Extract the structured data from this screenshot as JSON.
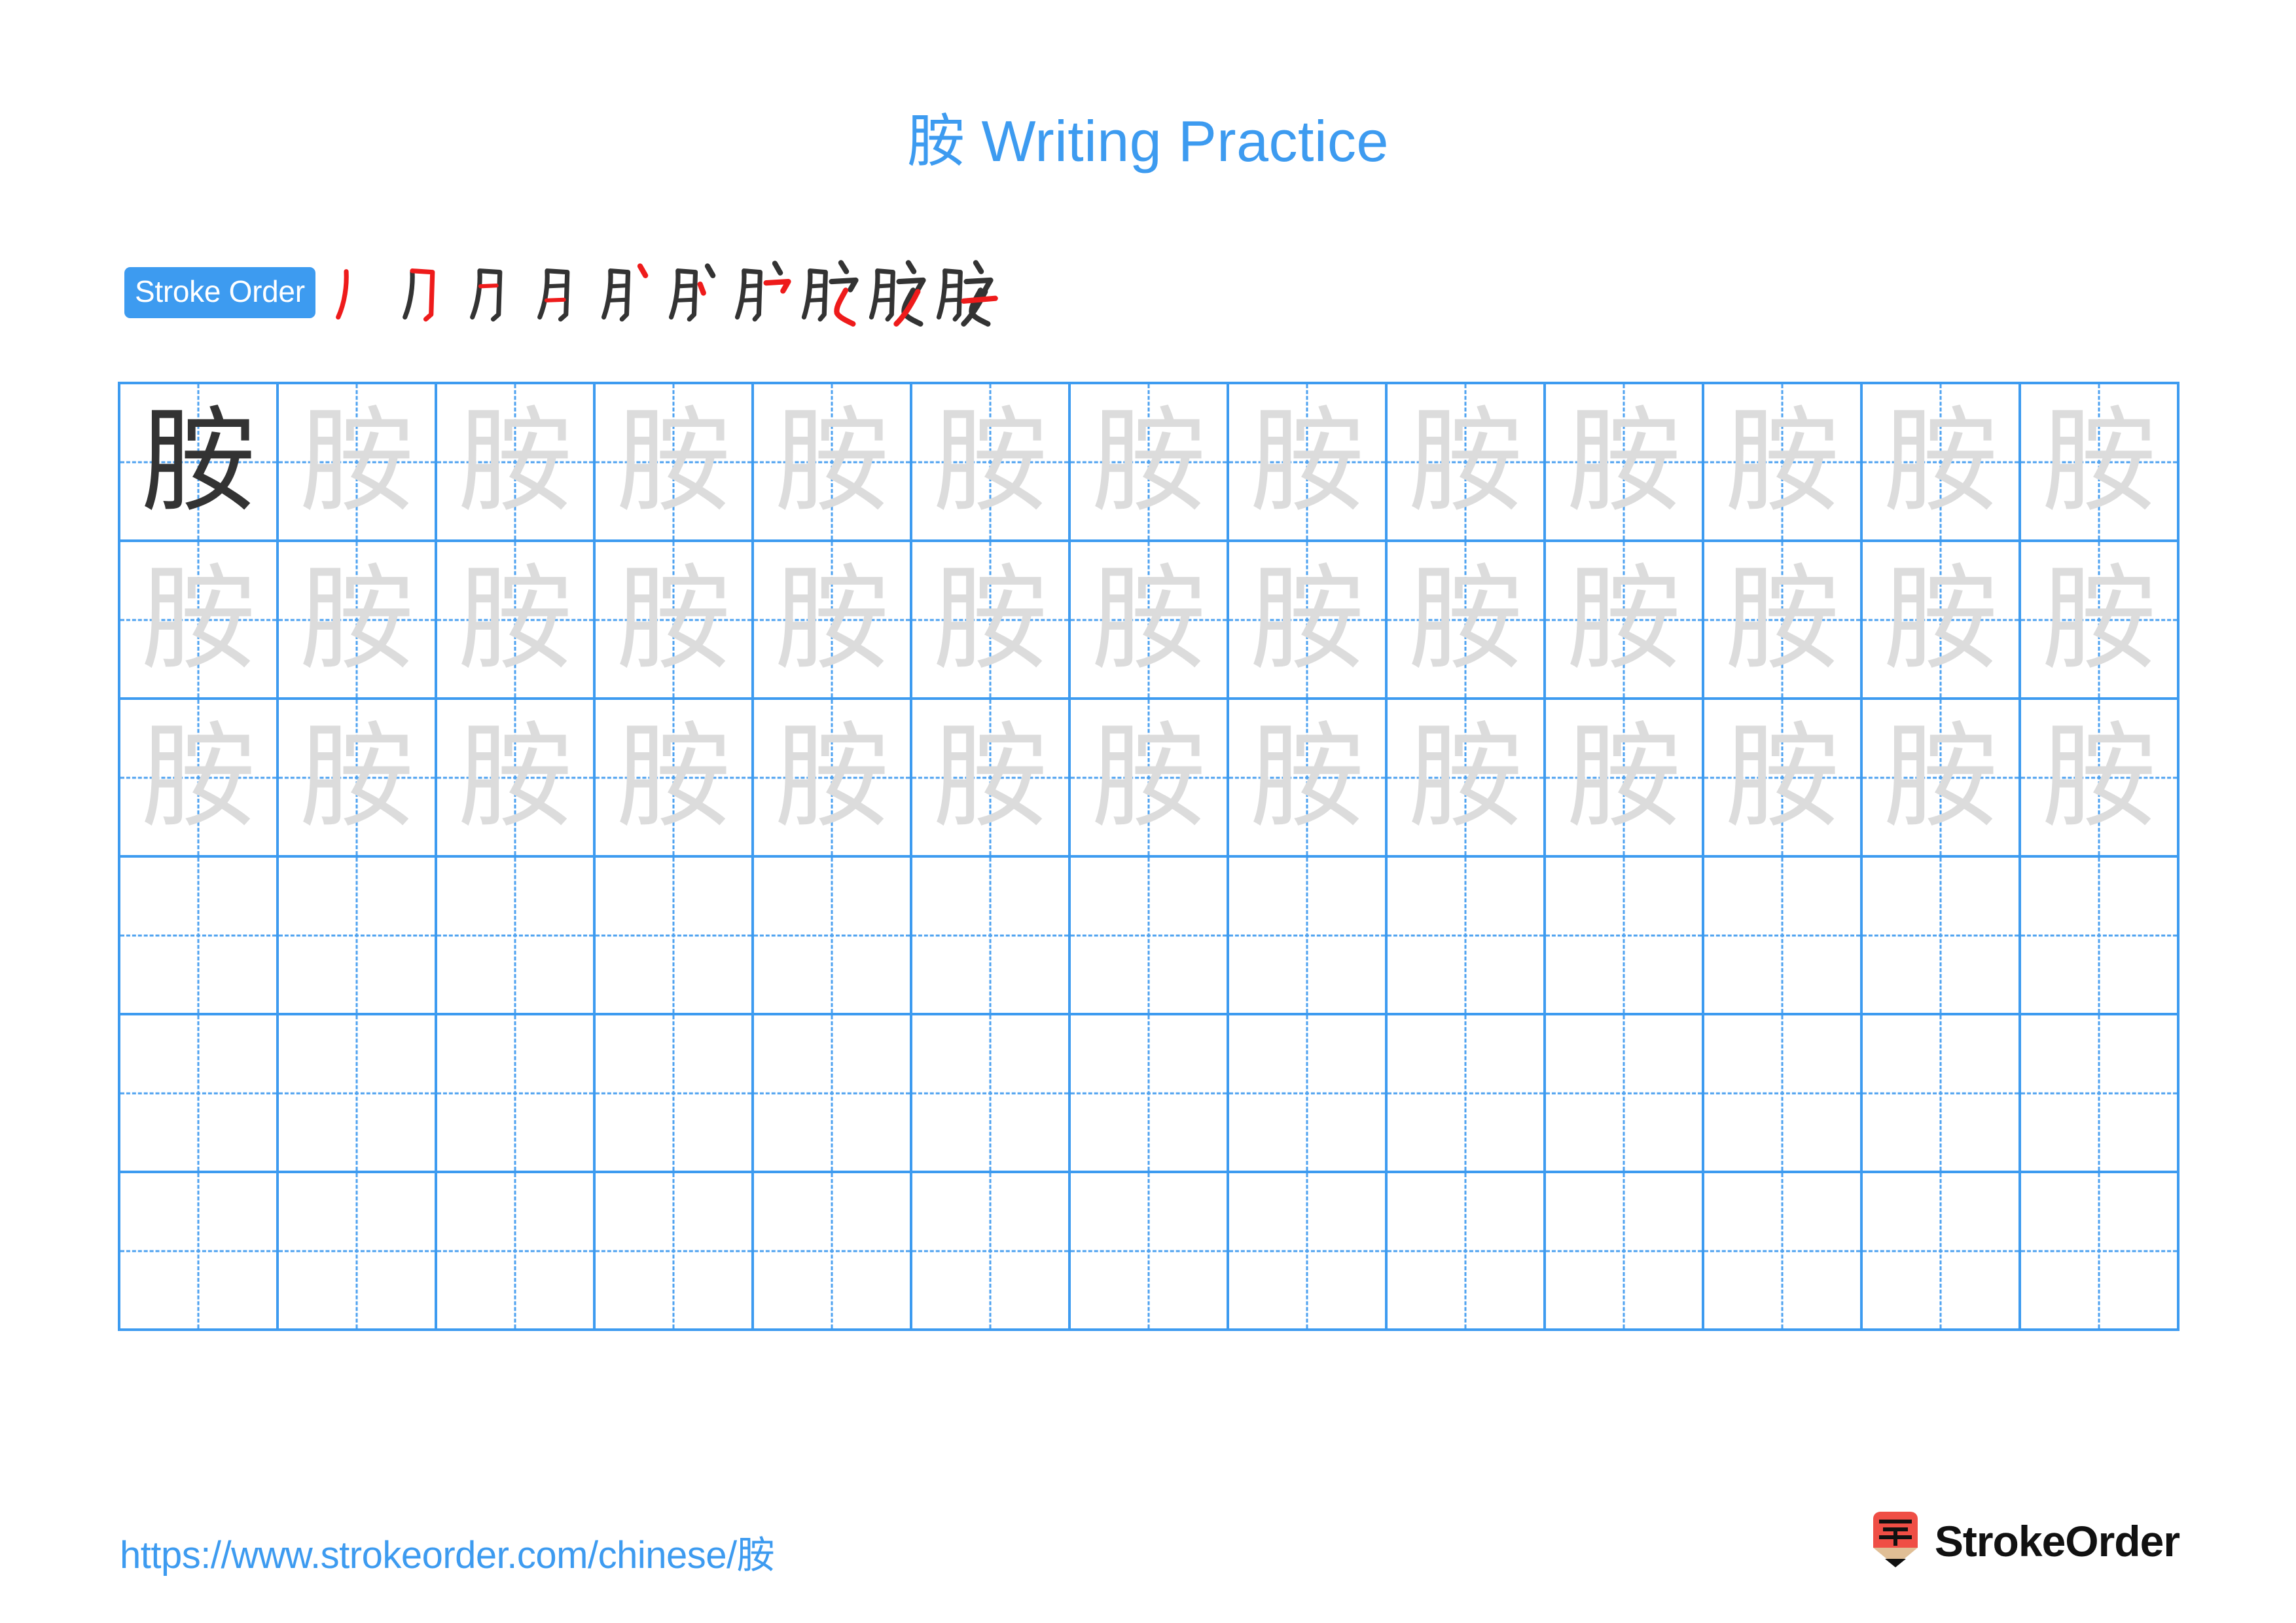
{
  "page": {
    "character": "胺",
    "title": "胺 Writing Practice",
    "title_character": "胺",
    "title_text": " Writing Practice"
  },
  "colors": {
    "accent_blue": "#3d9bf0",
    "grid_line_blue": "#3d9bf0",
    "guide_dash_blue": "#4ea2f0",
    "trace_gray": "#dcdcdc",
    "model_dark": "#333333",
    "stroke_new_red": "#ee1b1b",
    "logo_red": "#ef4e45",
    "logo_wood": "#e0be95",
    "logo_tip": "#111111"
  },
  "stroke_order": {
    "badge_label": "Stroke Order",
    "total_strokes": 10,
    "steps": [
      {
        "index": 1,
        "glyph": "丿",
        "new_stroke": "丿 (piě) left falling"
      },
      {
        "index": 2,
        "glyph": "刀",
        "new_stroke": "横折钩 (héngzhégōu)"
      },
      {
        "index": 3,
        "glyph": "月",
        "new_stroke": "横 (héng) first inner"
      },
      {
        "index": 4,
        "glyph": "月",
        "new_stroke": "横 (héng) second inner"
      },
      {
        "index": 5,
        "glyph": "月丶",
        "new_stroke": "点 (diǎn) of 宀"
      },
      {
        "index": 6,
        "glyph": "月丷",
        "new_stroke": "点 (diǎn) left of 宀"
      },
      {
        "index": 7,
        "glyph": "月宀",
        "new_stroke": "横钩 (hénggōu) of 宀"
      },
      {
        "index": 8,
        "glyph": "胶",
        "new_stroke": "撇点 (piědiǎn) of 女"
      },
      {
        "index": 9,
        "glyph": "胺",
        "new_stroke": "撇 (piě) of 女"
      },
      {
        "index": 10,
        "glyph": "胺",
        "new_stroke": "横 (héng) of 女"
      }
    ]
  },
  "grid": {
    "columns": 13,
    "rows": 6,
    "row_types": [
      "model-and-trace",
      "trace",
      "trace",
      "blank",
      "blank",
      "blank"
    ],
    "model_cell": {
      "row": 1,
      "column": 1,
      "character": "胺",
      "style": "dark"
    },
    "trace_character": "胺"
  },
  "footer": {
    "url_prefix": "https://www.strokeorder.com/chinese/",
    "url_character": "胺",
    "url_full": "https://www.strokeorder.com/chinese/胺",
    "brand_name": "StrokeOrder",
    "brand_mark_character": "字"
  }
}
